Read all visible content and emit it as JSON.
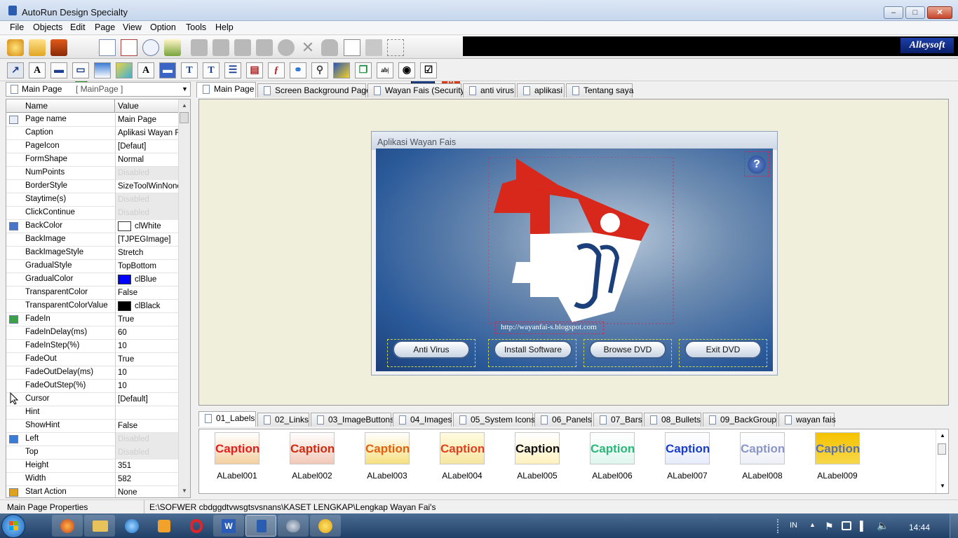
{
  "window": {
    "title": "AutoRun Design Specialty"
  },
  "menu": [
    "File",
    "Objects",
    "Edit",
    "Page",
    "View",
    "Option",
    "Tools",
    "Help"
  ],
  "brand": "Alleysoft",
  "toolbar2": [
    "A",
    "T",
    "T",
    "A"
  ],
  "page_selector": {
    "name": "Main Page",
    "id": "[ MainPage ]"
  },
  "props": {
    "headers": [
      "Name",
      "Value"
    ],
    "rows": [
      {
        "name": "Page name",
        "value": "Main Page"
      },
      {
        "name": "Caption",
        "value": "Aplikasi Wayan Fa"
      },
      {
        "name": "PageIcon",
        "value": "[Defaut]"
      },
      {
        "name": "FormShape",
        "value": "Normal"
      },
      {
        "name": "NumPoints",
        "value": "Disabled"
      },
      {
        "name": "BorderStyle",
        "value": "SizeToolWinNonel"
      },
      {
        "name": "Staytime(s)",
        "value": "Disabled"
      },
      {
        "name": "ClickContinue",
        "value": "Disabled"
      },
      {
        "name": "BackColor",
        "value": "clWhite"
      },
      {
        "name": "BackImage",
        "value": "[TJPEGImage]"
      },
      {
        "name": "BackImageStyle",
        "value": "Stretch"
      },
      {
        "name": "GradualStyle",
        "value": "TopBottom"
      },
      {
        "name": "GradualColor",
        "value": "clBlue"
      },
      {
        "name": "TransparentColor",
        "value": "False"
      },
      {
        "name": "TransparentColorValue",
        "value": "clBlack"
      },
      {
        "name": "FadeIn",
        "value": "True"
      },
      {
        "name": "FadeInDelay(ms)",
        "value": "60"
      },
      {
        "name": "FadeInStep(%)",
        "value": "10"
      },
      {
        "name": "FadeOut",
        "value": "True"
      },
      {
        "name": "FadeOutDelay(ms)",
        "value": "10"
      },
      {
        "name": "FadeOutStep(%)",
        "value": "10"
      },
      {
        "name": "Cursor",
        "value": "[Default]"
      },
      {
        "name": "Hint",
        "value": ""
      },
      {
        "name": "ShowHint",
        "value": "False"
      },
      {
        "name": "Left",
        "value": "Disabled"
      },
      {
        "name": "Top",
        "value": "Disabled"
      },
      {
        "name": "Height",
        "value": "351"
      },
      {
        "name": "Width",
        "value": "582"
      },
      {
        "name": "Start Action",
        "value": "None"
      }
    ]
  },
  "page_tabs": [
    "Main Page",
    "Screen Background Page",
    "Wayan Fais (Security)",
    "anti virus",
    "aplikasi",
    "Tentang saya"
  ],
  "design": {
    "dialog_title": "Aplikasi Wayan Fais",
    "url": "http://wayanfai-s.blogspot.com",
    "buttons": [
      "Anti Virus",
      "Install Software",
      "Browse DVD",
      "Exit DVD"
    ]
  },
  "comp_tabs": [
    "01_Labels",
    "02_Links",
    "03_ImageButtons",
    "04_Images",
    "05_System Icons",
    "06_Panels",
    "07_Bars",
    "08_Bullets",
    "09_BackGroup",
    "wayan fais"
  ],
  "components": {
    "caption_text": "Caption",
    "items": [
      "ALabel001",
      "ALabel002",
      "ALabel003",
      "ALabel004",
      "ALabel005",
      "ALabel006",
      "ALabel007",
      "ALabel008",
      "ALabel009"
    ]
  },
  "status": {
    "left": "Main Page Properties",
    "path": "E:\\SOFWER cbdggdtvwsgtsvsnans\\KASET LENGKAP\\Lengkap Wayan Fai's"
  },
  "taskbar": {
    "lang": "IN",
    "time": "14:44"
  },
  "colors": {
    "swatch_white": "#ffffff",
    "swatch_blue": "#0000ff",
    "swatch_black": "#000000"
  }
}
